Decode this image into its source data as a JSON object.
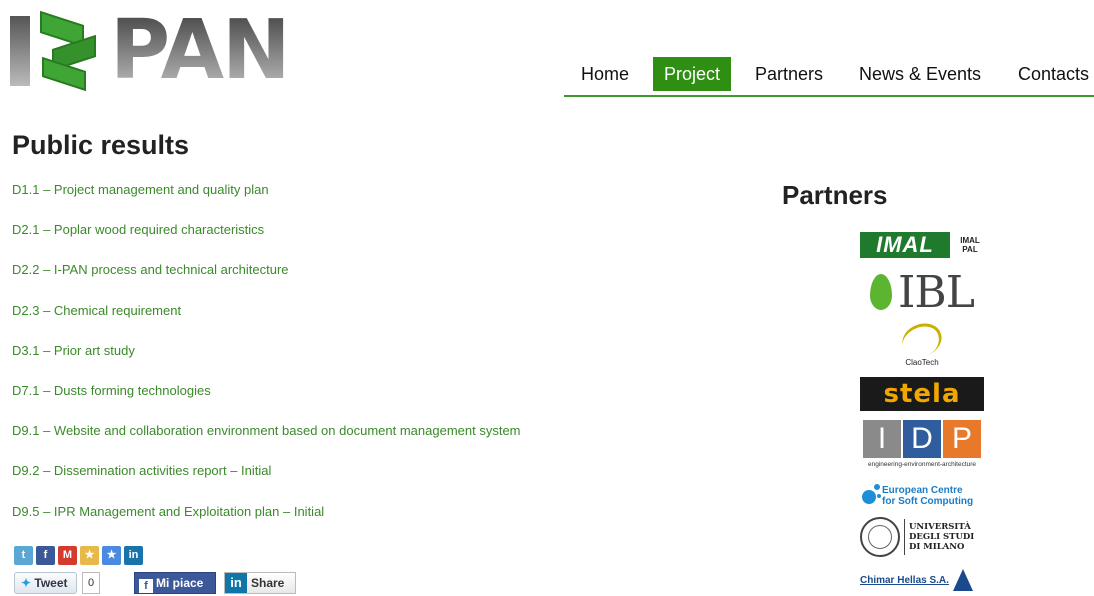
{
  "logo": {
    "letter_i": "I",
    "wordmark": "PAN"
  },
  "nav": [
    {
      "label": "Home",
      "active": false
    },
    {
      "label": "Project",
      "active": true
    },
    {
      "label": "Partners",
      "active": false
    },
    {
      "label": "News & Events",
      "active": false
    },
    {
      "label": "Contacts",
      "active": false
    }
  ],
  "main": {
    "title": "Public results",
    "results": [
      "D1.1 – Project management and quality plan",
      "D2.1 – Poplar wood required characteristics",
      "D2.2 – I-PAN process and technical architecture",
      "D2.3 – Chemical requirement",
      "D3.1 – Prior art study",
      "D7.1 – Dusts forming technologies",
      "D9.1 – Website and collaboration environment based on document management system",
      "D9.2 – Dissemination activities report – Initial",
      "D9.5 – IPR Management and Exploitation plan – Initial"
    ]
  },
  "social": {
    "icons": [
      {
        "name": "twitter-icon",
        "glyph": "t",
        "color": "#5aa7d6"
      },
      {
        "name": "facebook-icon",
        "glyph": "f",
        "color": "#3b5998"
      },
      {
        "name": "gmail-icon",
        "glyph": "M",
        "color": "#d53b2c"
      },
      {
        "name": "favorite-star-icon",
        "glyph": "★",
        "color": "#e8b84a"
      },
      {
        "name": "google-bookmarks-icon",
        "glyph": "★",
        "color": "#4a8ae0"
      },
      {
        "name": "linkedin-icon",
        "glyph": "in",
        "color": "#1a74ac"
      }
    ],
    "tweet_label": "Tweet",
    "tweet_count": "0",
    "like_label": "Mi piace",
    "share_label": "Share"
  },
  "sidebar": {
    "title": "Partners",
    "partners": {
      "imal": {
        "main": "IMAL",
        "sub": "IMAL PAL"
      },
      "ibl": "IBL",
      "claotech": "ClaoTech",
      "stela": "stela",
      "idp": {
        "letters": [
          "I",
          "D",
          "P"
        ],
        "tagline": "engineering-environment-architecture",
        "colors": [
          "#8a8a8a",
          "#2f5d9e",
          "#e8782a"
        ]
      },
      "ecsc": {
        "line1": "European Centre",
        "line2": "for Soft Computing"
      },
      "unimi": {
        "line1": "UNIVERSITÀ",
        "line2": "DEGLI STUDI",
        "line3": "DI MILANO"
      },
      "chimar": "Chimar Hellas S.A."
    }
  },
  "colors": {
    "accent": "#2f8f13",
    "link": "#3a8a2a"
  }
}
